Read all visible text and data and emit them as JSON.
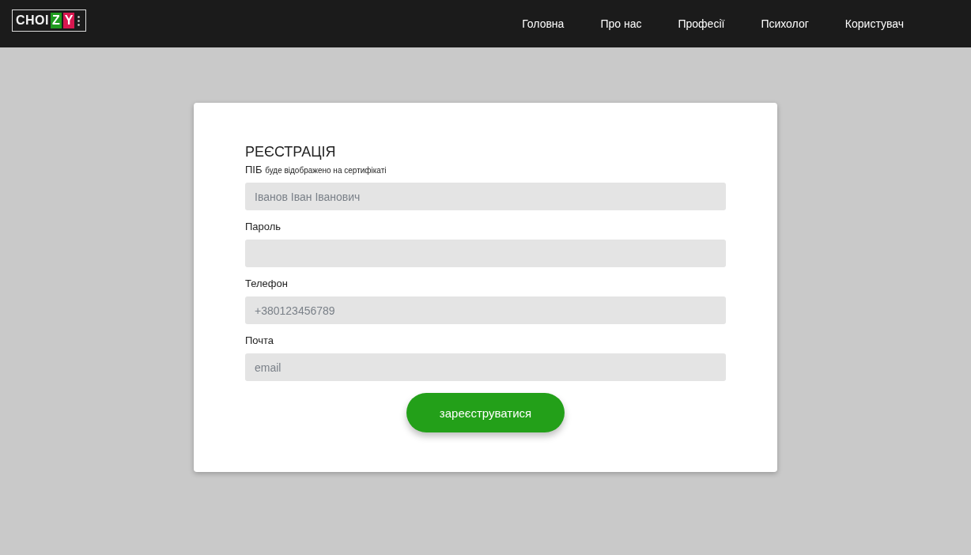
{
  "logo": {
    "text": "CHOI",
    "letters": [
      {
        "text": "Z",
        "color": "#1f9a1f"
      },
      {
        "text": "Y",
        "color": "#d8174f"
      }
    ]
  },
  "nav": [
    "Головна",
    "Про нас",
    "Професії",
    "Психолог",
    "Користувач"
  ],
  "form": {
    "title": "РЕЄСТРАЦІЯ",
    "fields": [
      {
        "label": "ПІБ",
        "hint": "буде відображено на сертифікаті",
        "placeholder": "Іванов Іван Іванович"
      },
      {
        "label": "Пароль"
      },
      {
        "label": "Телефон",
        "placeholder": "+380123456789"
      },
      {
        "label": "Почта",
        "placeholder": "email"
      }
    ],
    "submit": "зареєструватися"
  }
}
